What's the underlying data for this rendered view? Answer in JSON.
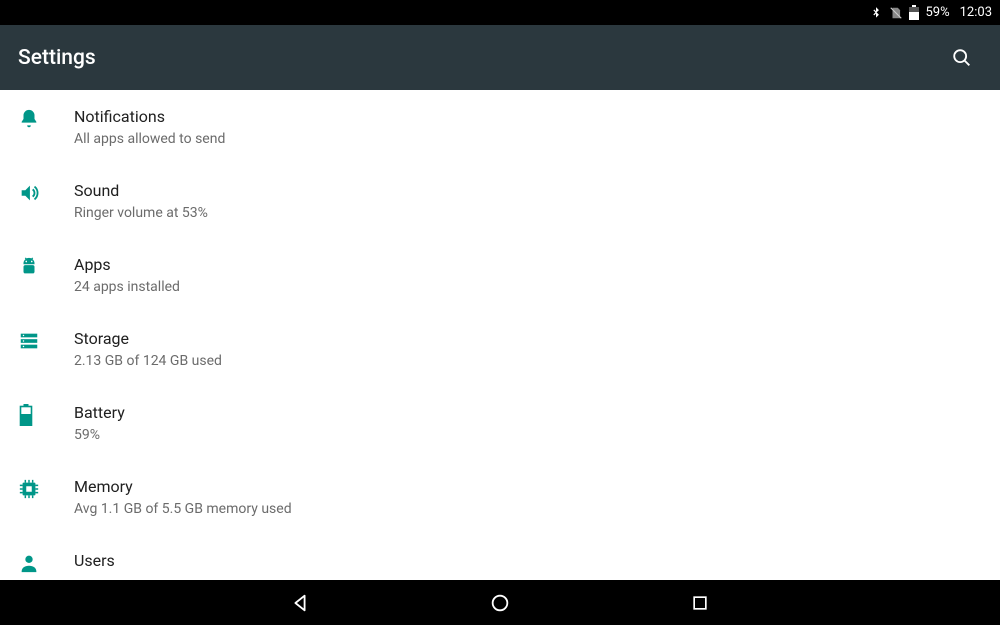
{
  "status": {
    "battery_pct": "59%",
    "time": "12:03"
  },
  "appbar": {
    "title": "Settings"
  },
  "colors": {
    "teal": "#009688"
  },
  "items": [
    {
      "id": "notifications",
      "icon": "bell",
      "title": "Notifications",
      "sub": "All apps allowed to send"
    },
    {
      "id": "sound",
      "icon": "volume",
      "title": "Sound",
      "sub": "Ringer volume at 53%"
    },
    {
      "id": "apps",
      "icon": "android",
      "title": "Apps",
      "sub": "24 apps installed"
    },
    {
      "id": "storage",
      "icon": "storage",
      "title": "Storage",
      "sub": "2.13 GB of 124 GB used"
    },
    {
      "id": "battery",
      "icon": "battery",
      "title": "Battery",
      "sub": "59%"
    },
    {
      "id": "memory",
      "icon": "memory",
      "title": "Memory",
      "sub": "Avg 1.1 GB of 5.5 GB memory used"
    },
    {
      "id": "users",
      "icon": "user",
      "title": "Users",
      "sub": ""
    }
  ]
}
